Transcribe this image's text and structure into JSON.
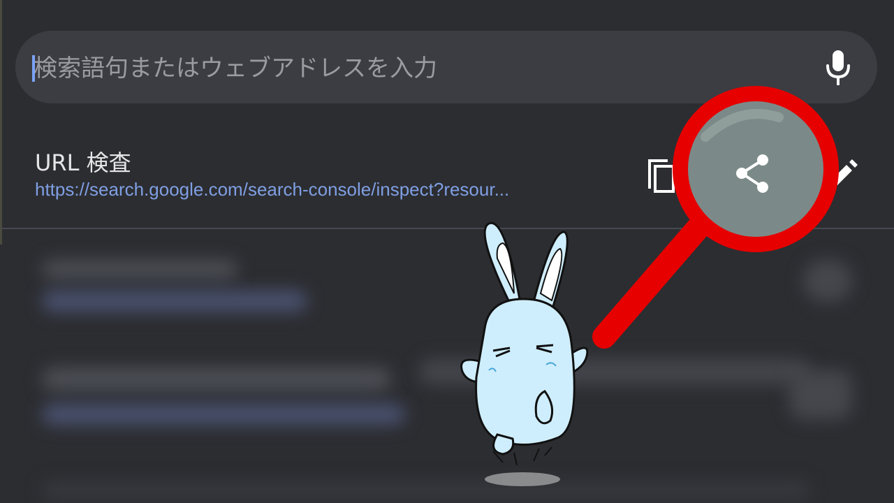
{
  "search": {
    "placeholder": "検索語句またはウェブアドレスを入力"
  },
  "result": {
    "title": "URL 検査",
    "url": "https://search.google.com/search-console/inspect?resour..."
  },
  "icons": {
    "mic": "mic-icon",
    "copy": "copy-icon",
    "share": "share-icon",
    "edit": "edit-icon",
    "magnifier": "magnifier-icon",
    "mascot": "rabbit-mascot"
  },
  "colors": {
    "background": "#2c2d31",
    "search_bar": "#3b3d42",
    "link": "#7f9fe3",
    "highlight_ring": "#e60000",
    "lens_fill": "#7b8a88"
  }
}
